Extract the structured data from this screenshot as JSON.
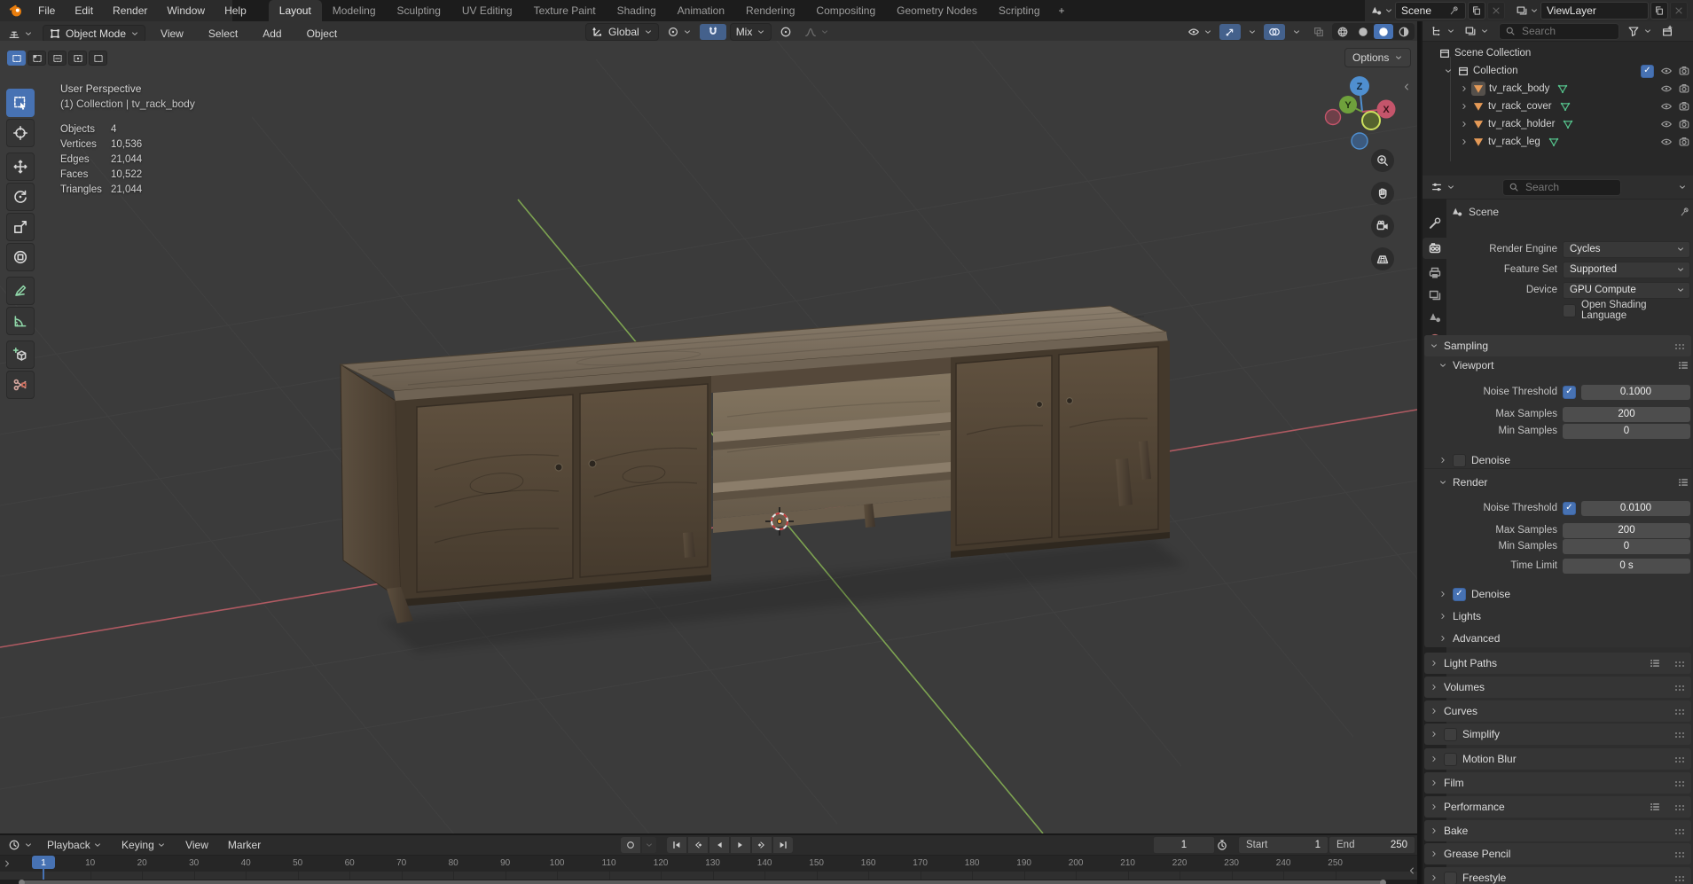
{
  "topbar": {
    "menus": [
      "File",
      "Edit",
      "Render",
      "Window",
      "Help"
    ],
    "tabs": [
      {
        "label": "Layout",
        "active": true
      },
      {
        "label": "Modeling"
      },
      {
        "label": "Sculpting"
      },
      {
        "label": "UV Editing"
      },
      {
        "label": "Texture Paint"
      },
      {
        "label": "Shading"
      },
      {
        "label": "Animation"
      },
      {
        "label": "Rendering"
      },
      {
        "label": "Compositing"
      },
      {
        "label": "Geometry Nodes"
      },
      {
        "label": "Scripting"
      }
    ],
    "add_tab": "+",
    "scene": {
      "label": "Scene"
    },
    "view_layer": {
      "label": "ViewLayer"
    }
  },
  "viewport_header": {
    "mode": "Object Mode",
    "menus": [
      "View",
      "Select",
      "Add",
      "Object"
    ],
    "orientation": "Global",
    "snap_target": "Mix",
    "options_label": "Options"
  },
  "viewport": {
    "view_label": "User Perspective",
    "context_label": "(1) Collection | tv_rack_body",
    "stats": [
      {
        "label": "Objects",
        "value": "4"
      },
      {
        "label": "Vertices",
        "value": "10,536"
      },
      {
        "label": "Edges",
        "value": "21,044"
      },
      {
        "label": "Faces",
        "value": "10,522"
      },
      {
        "label": "Triangles",
        "value": "21,044"
      }
    ],
    "gizmo": {
      "x": "X",
      "y": "Y",
      "z": "Z"
    }
  },
  "outliner": {
    "search_placeholder": "Search",
    "root_label": "Scene Collection",
    "collection": {
      "label": "Collection",
      "checked": true
    },
    "objects": [
      {
        "label": "tv_rack_body",
        "active": true
      },
      {
        "label": "tv_rack_cover"
      },
      {
        "label": "tv_rack_holder"
      },
      {
        "label": "tv_rack_leg"
      }
    ]
  },
  "properties": {
    "search_placeholder": "Search",
    "breadcrumb": "Scene",
    "render_engine": {
      "label": "Render Engine",
      "value": "Cycles"
    },
    "feature_set": {
      "label": "Feature Set",
      "value": "Supported"
    },
    "device": {
      "label": "Device",
      "value": "GPU Compute"
    },
    "osl": {
      "label": "Open Shading Language",
      "checked": false
    },
    "sampling": {
      "title": "Sampling",
      "viewport": {
        "title": "Viewport",
        "noise_threshold": {
          "label": "Noise Threshold",
          "value": "0.1000",
          "checked": true
        },
        "max_samples": {
          "label": "Max Samples",
          "value": "200"
        },
        "min_samples": {
          "label": "Min Samples",
          "value": "0"
        },
        "denoise": {
          "label": "Denoise",
          "checked": false
        }
      },
      "render": {
        "title": "Render",
        "noise_threshold": {
          "label": "Noise Threshold",
          "value": "0.0100",
          "checked": true
        },
        "max_samples": {
          "label": "Max Samples",
          "value": "200"
        },
        "min_samples": {
          "label": "Min Samples",
          "value": "0"
        },
        "time_limit": {
          "label": "Time Limit",
          "value": "0 s"
        },
        "denoise": {
          "label": "Denoise",
          "checked": true
        },
        "lights": {
          "label": "Lights"
        },
        "advanced": {
          "label": "Advanced"
        }
      }
    },
    "panels": [
      {
        "label": "Light Paths"
      },
      {
        "label": "Volumes"
      },
      {
        "label": "Curves"
      },
      {
        "label": "Simplify",
        "checked": false
      },
      {
        "label": "Motion Blur",
        "checked": false
      },
      {
        "label": "Film"
      },
      {
        "label": "Performance"
      },
      {
        "label": "Bake"
      },
      {
        "label": "Grease Pencil"
      },
      {
        "label": "Freestyle",
        "checked": false
      }
    ]
  },
  "timeline": {
    "menus": [
      "Playback",
      "Keying",
      "View",
      "Marker"
    ],
    "current_frame": 1,
    "frame_display": "1",
    "start": {
      "label": "Start",
      "value": "1"
    },
    "end": {
      "label": "End",
      "value": "250"
    },
    "ticks": [
      10,
      20,
      30,
      40,
      50,
      60,
      70,
      80,
      90,
      100,
      110,
      120,
      130,
      140,
      150,
      160,
      170,
      180,
      190,
      200,
      210,
      220,
      230,
      240,
      250
    ]
  },
  "colors": {
    "accent": "#4772b3",
    "axis_x": "#b05a62",
    "axis_y": "#7da351",
    "object_orange": "#e59a57",
    "mesh_data_green": "#54c08a",
    "viewport_bg": "#3b3b3b"
  }
}
